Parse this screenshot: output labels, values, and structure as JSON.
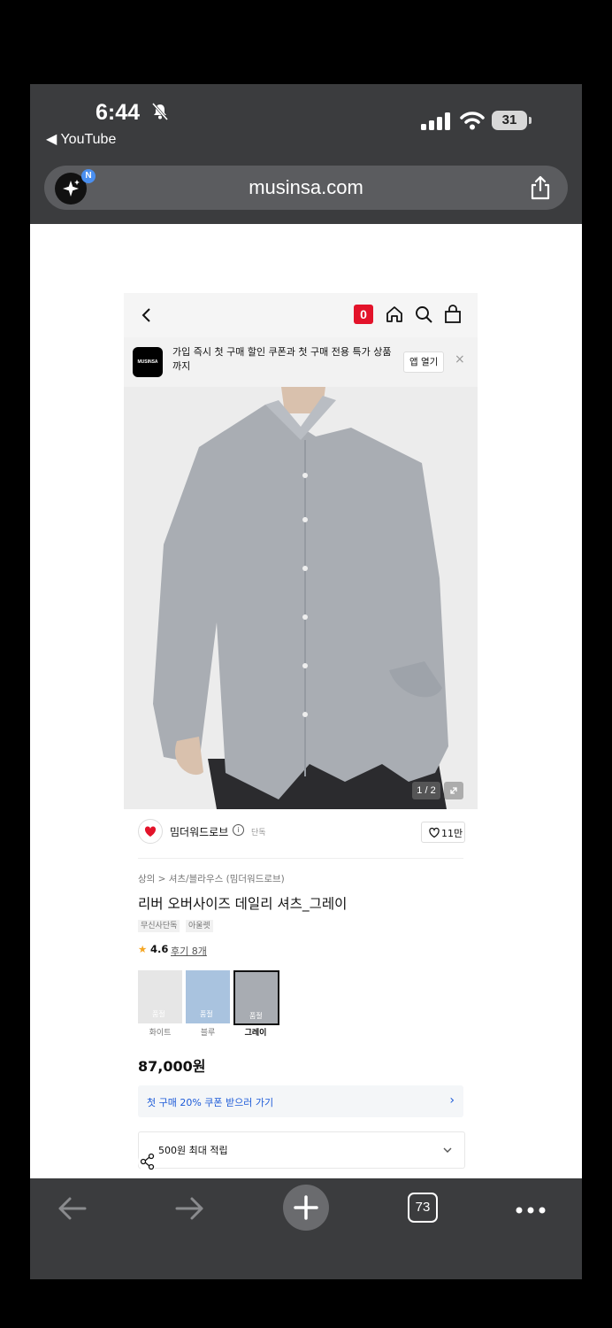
{
  "status_bar": {
    "time": "6:44",
    "back_app": "◀ YouTube",
    "battery": "31"
  },
  "url_bar": {
    "ai_badge": "N",
    "url": "musinsa.com"
  },
  "nav": {
    "cart_count": "0"
  },
  "app_banner": {
    "logo_text": "MUSINSA",
    "text": "가입 즉시 첫 구매 할인 쿠폰과 첫 구매 전용 특가 상품까지",
    "open_label": "앱 열기",
    "close_label": "×"
  },
  "gallery": {
    "counter": "1 / 2"
  },
  "brand": {
    "name": "밈더워드로브",
    "tag": "단독",
    "likes": "11만"
  },
  "product": {
    "breadcrumb": "상의 > 셔츠/블라우스 (밈더워드로브)",
    "title": "리버 오버사이즈 데일리 셔츠_그레이",
    "tags": [
      "무신사단독",
      "아울렛"
    ],
    "rating": "4.6",
    "reviews": "후기 8개",
    "price": "87,000원"
  },
  "swatches": [
    {
      "label": "화이트",
      "badge": "품절",
      "color": "#e6e6e6"
    },
    {
      "label": "블루",
      "badge": "품절",
      "color": "#a9c3df"
    },
    {
      "label": "그레이",
      "badge": "품절",
      "color": "#a8acb2"
    }
  ],
  "coupon": {
    "text": "첫 구매 20% 쿠폰 받으러 가기",
    "accent": "#1d5bd8"
  },
  "points": {
    "text": "500원 최대 적립"
  },
  "toolbar": {
    "tab_count": "73"
  },
  "colors": {
    "chrome_dark": "#3b3c3e",
    "brand_red": "#e3132a"
  }
}
